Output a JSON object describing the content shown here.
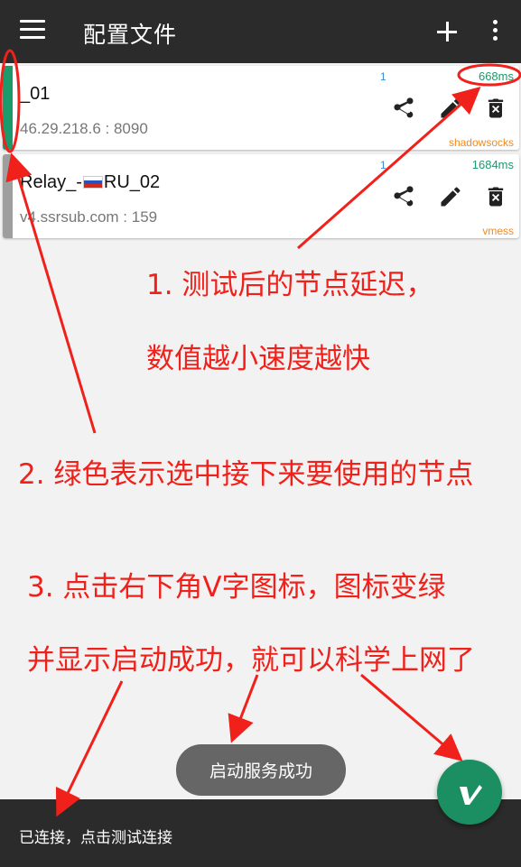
{
  "appbar": {
    "title": "配置文件",
    "menu_icon": "menu-icon",
    "add_icon": "plus-icon",
    "more_icon": "more-vert-icon"
  },
  "servers": [
    {
      "name": "_01",
      "address": "46.29.218.6 : 8090",
      "index": "1",
      "latency": "668ms",
      "type": "shadowsocks",
      "selected": true,
      "bar_color": "#1b9a6c"
    },
    {
      "name_prefix": "Relay_-",
      "name_suffix": "RU_02",
      "address": "v4.ssrsub.com : 159",
      "index": "1",
      "latency": "1684ms",
      "type": "vmess",
      "selected": false,
      "bar_color": "#9e9e9e"
    }
  ],
  "annotations": {
    "note1_line1": "1. 测试后的节点延迟，",
    "note1_line2": "数值越小速度越快",
    "note2": "2. 绿色表示选中接下来要使用的节点",
    "note3_line1": "3. 点击右下角V字图标，图标变绿",
    "note3_line2": "并显示启动成功，就可以科学上网了"
  },
  "toast": "启动服务成功",
  "status_bar": {
    "text": "已连接，点击测试连接"
  },
  "colors": {
    "accent_green": "#1b8f61",
    "annotation_red": "#f0201a",
    "type_orange": "#f08a24",
    "index_blue": "#3a8ccf"
  }
}
